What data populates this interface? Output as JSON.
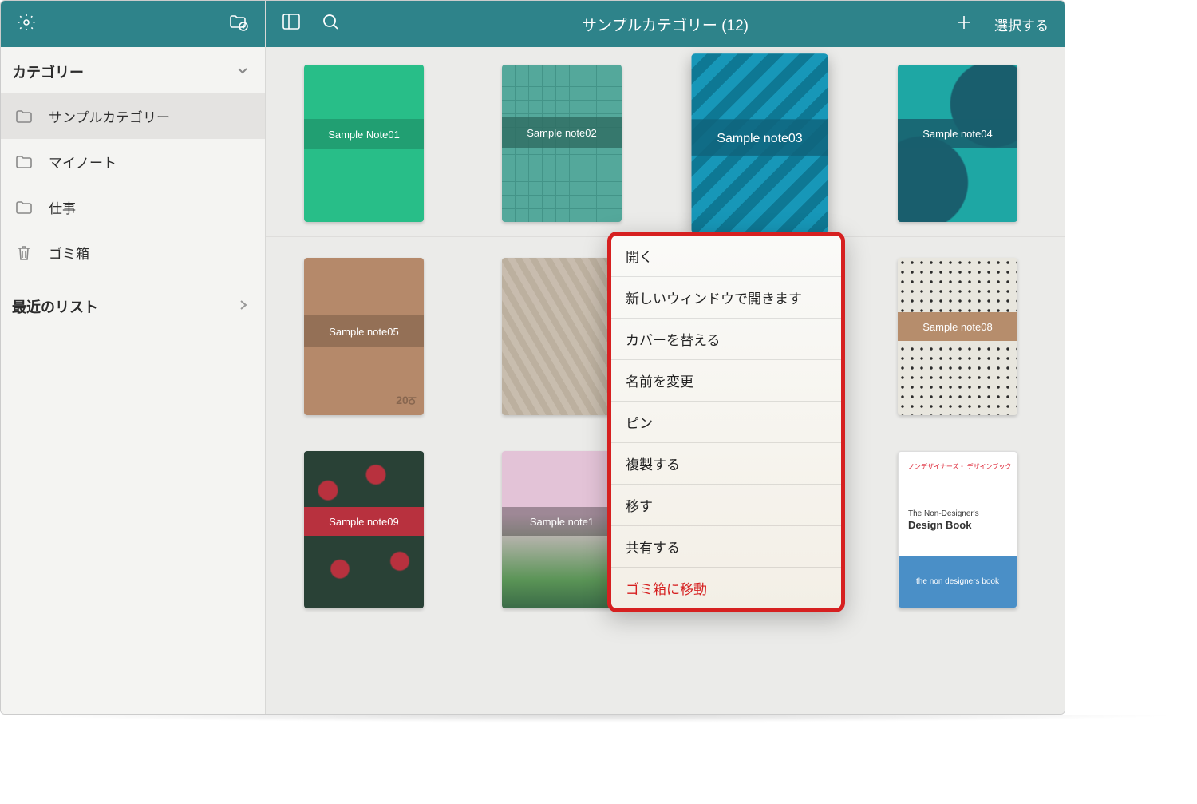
{
  "header": {
    "title": "サンプルカテゴリー (12)",
    "select_button": "選択する"
  },
  "sidebar": {
    "categories_title": "カテゴリー",
    "recent_title": "最近のリスト",
    "items": [
      {
        "label": "サンプルカテゴリー",
        "icon": "folder"
      },
      {
        "label": "マイノート",
        "icon": "folder"
      },
      {
        "label": "仕事",
        "icon": "folder"
      },
      {
        "label": "ゴミ箱",
        "icon": "trash"
      }
    ]
  },
  "notes": {
    "row1": [
      {
        "title": "Sample Note01"
      },
      {
        "title": "Sample note02"
      },
      {
        "title": "Sample note03"
      },
      {
        "title": "Sample note04"
      }
    ],
    "row2": [
      {
        "title": "Sample note05"
      },
      {
        "title": ""
      },
      {
        "title": ""
      },
      {
        "title": "Sample note08"
      }
    ],
    "row3": [
      {
        "title": "Sample note09"
      },
      {
        "title": "Sample note1"
      },
      {
        "title": ""
      },
      {
        "title": "the non designers book",
        "subtitle1": "ノンデザイナーズ・\nデザインブック",
        "subtitle2": "The Non-Designer's",
        "subtitle3": "Design Book"
      }
    ]
  },
  "context_menu": {
    "items": [
      "開く",
      "新しいウィンドウで開きます",
      "カバーを替える",
      "名前を変更",
      "ピン",
      "複製する",
      "移す",
      "共有する",
      "ゴミ箱に移動"
    ]
  }
}
